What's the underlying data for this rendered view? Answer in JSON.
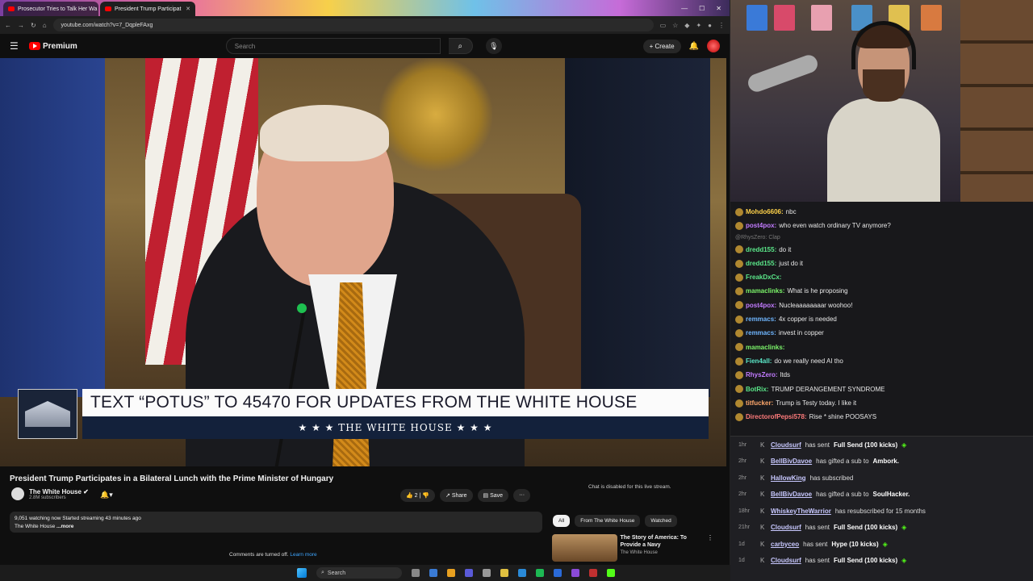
{
  "browser": {
    "tabs": [
      {
        "label": "Prosecutor Tries to Talk Her Wa"
      },
      {
        "label": "President Trump Participat"
      }
    ],
    "url": "youtube.com/watch?v=7_DqpleFAxg"
  },
  "youtube": {
    "brand": "Premium",
    "search_placeholder": "Search",
    "create_label": "Create"
  },
  "video": {
    "lower_third_text": "TEXT “POTUS” TO 45470 FOR UPDATES FROM THE WHITE HOUSE",
    "lower_third_sub": "★ ★ ★  THE WHITE HOUSE  ★ ★ ★",
    "title": "President Trump Participates in a Bilateral Lunch with the Prime Minister of Hungary",
    "channel": "The White House",
    "subscribers": "2.8M subscribers",
    "likes": "2",
    "share_label": "Share",
    "save_label": "Save",
    "desc_stats": "9,051 watching now  Started streaming 43 minutes ago",
    "desc_text": "The White House",
    "desc_more": "...more",
    "comments_off": "Comments are turned off.",
    "learn_more": "Learn more",
    "chat_disabled": "Chat is disabled for this live stream.",
    "chips": [
      "All",
      "From The White House",
      "Watched"
    ],
    "rec_title": "The Story of America: To Provide a Navy",
    "rec_channel": "The White House"
  },
  "chat": {
    "messages": [
      {
        "user": "Mohdo6606:",
        "text": "nbc",
        "color": "#ffd24a"
      },
      {
        "user": "post4pox:",
        "text": "who even watch ordinary TV anymore?",
        "color": "#c27bff"
      },
      {
        "reply": "@RhysZero: Clap"
      },
      {
        "user": "dredd155:",
        "text": "do it",
        "color": "#5be88a"
      },
      {
        "user": "dredd155:",
        "text": "just do it",
        "color": "#5be88a"
      },
      {
        "user": "FreakDxCx:",
        "text": "",
        "color": "#5be88a"
      },
      {
        "user": "mamaclinks:",
        "text": "What is he proposing",
        "color": "#7cf56a"
      },
      {
        "user": "post4pox:",
        "text": "Nucleaaaaaaaar woohoo!",
        "color": "#c27bff"
      },
      {
        "user": "remmacs:",
        "text": "4x copper is needed",
        "color": "#6fb6ff"
      },
      {
        "user": "remmacs:",
        "text": "invest in copper",
        "color": "#6fb6ff"
      },
      {
        "user": "mamaclinks:",
        "text": "",
        "color": "#7cf56a"
      },
      {
        "user": "Fien4all:",
        "text": "do we really need AI tho",
        "color": "#5be8c8"
      },
      {
        "user": "RhysZero:",
        "text": "ltds",
        "color": "#c27bff"
      },
      {
        "user": "BotRix:",
        "text": "TRUMP DERANGEMENT SYNDROME",
        "color": "#5be88a"
      },
      {
        "user": "titfucker:",
        "text": "Trump is Testy today. I like it",
        "color": "#ffa86b"
      },
      {
        "user": "DirectorofPepsi578:",
        "text": "Rise * shine POOSAYS",
        "color": "#ff7b7b"
      }
    ]
  },
  "alerts": [
    {
      "time": "1hr",
      "user": "Cloudsurf",
      "text": "has sent",
      "bold": "Full Send (100 kicks)"
    },
    {
      "time": "2hr",
      "user": "BellBivDavoe",
      "text": "has gifted a sub to",
      "bold": "Ambork."
    },
    {
      "time": "2hr",
      "user": "HallowKing",
      "text": "has subscribed",
      "bold": ""
    },
    {
      "time": "2hr",
      "user": "BellBivDavoe",
      "text": "has gifted a sub to",
      "bold": "SoulHacker."
    },
    {
      "time": "18hr",
      "user": "WhiskeyTheWarrior",
      "text": "has resubscribed for 15 months",
      "bold": ""
    },
    {
      "time": "21hr",
      "user": "Cloudsurf",
      "text": "has sent",
      "bold": "Full Send (100 kicks)"
    },
    {
      "time": "1d",
      "user": "carbyceo",
      "text": "has sent",
      "bold": "Hype (10 kicks)"
    },
    {
      "time": "1d",
      "user": "Cloudsurf",
      "text": "has sent",
      "bold": "Full Send (100 kicks)"
    }
  ],
  "taskbar": {
    "search": "Search"
  }
}
